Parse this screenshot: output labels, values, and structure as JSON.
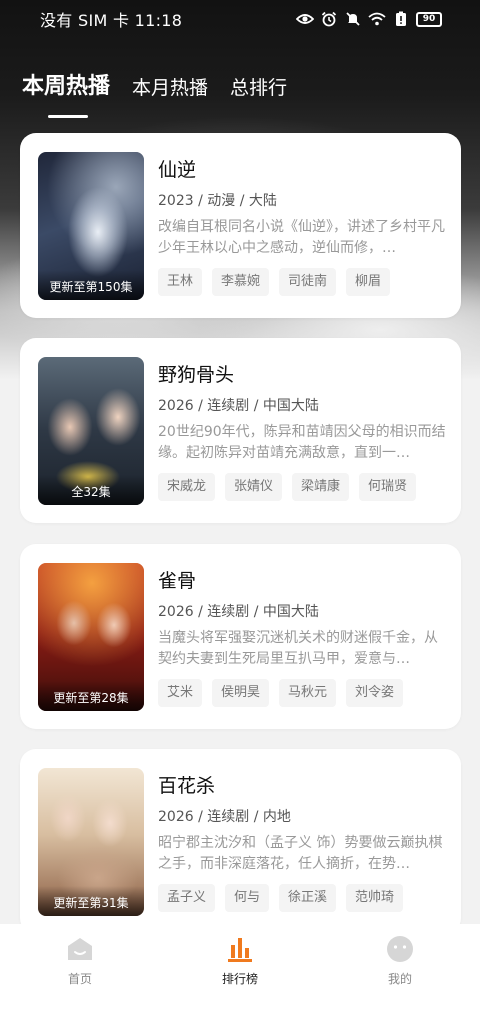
{
  "status_bar": {
    "left_text": "没有 SIM 卡 11:18",
    "battery": "90",
    "icons": [
      "eye-icon",
      "alarm-icon",
      "mute-icon",
      "wifi-icon",
      "battery-alert-icon",
      "battery-icon"
    ]
  },
  "tabs": [
    {
      "label": "本周热播",
      "active": true
    },
    {
      "label": "本月热播",
      "active": false
    },
    {
      "label": "总排行",
      "active": false
    }
  ],
  "cards": [
    {
      "title": "仙逆",
      "meta": "2023 / 动漫 / 大陆",
      "desc": "改编自耳根同名小说《仙逆》，讲述了乡村平凡少年王林以心中之感动，逆仙而修，…",
      "badge": "更新至第150集",
      "cast": [
        "王林",
        "李慕婉",
        "司徒南",
        "柳眉"
      ]
    },
    {
      "title": "野狗骨头",
      "meta": "2026 / 连续剧 / 中国大陆",
      "desc": "20世纪90年代，陈异和苗靖因父母的相识而结缘。起初陈异对苗靖充满敌意，直到一…",
      "badge": "全32集",
      "cast": [
        "宋威龙",
        "张婧仪",
        "梁靖康",
        "何瑞贤"
      ]
    },
    {
      "title": "雀骨",
      "meta": "2026 / 连续剧 / 中国大陆",
      "desc": "当魔头将军强娶沉迷机关术的财迷假千金，从契约夫妻到生死局里互扒马甲，爱意与…",
      "badge": "更新至第28集",
      "cast": [
        "艾米",
        "侯明昊",
        "马秋元",
        "刘令姿"
      ]
    },
    {
      "title": "百花杀",
      "meta": "2026 / 连续剧 / 内地",
      "desc": "昭宁郡主沈汐和（孟子义 饰）势要做云巅执棋之手，而非深庭落花，任人摘折，在势…",
      "badge": "更新至第31集",
      "cast": [
        "孟子义",
        "何与",
        "徐正溪",
        "范帅琦"
      ]
    }
  ],
  "nav": [
    {
      "label": "首页",
      "icon": "home-icon",
      "active": false
    },
    {
      "label": "排行榜",
      "icon": "ranking-icon",
      "active": true
    },
    {
      "label": "我的",
      "icon": "profile-icon",
      "active": false
    }
  ],
  "colors": {
    "accent": "#f07a1e",
    "inactive_icon": "#d6d6d6"
  }
}
